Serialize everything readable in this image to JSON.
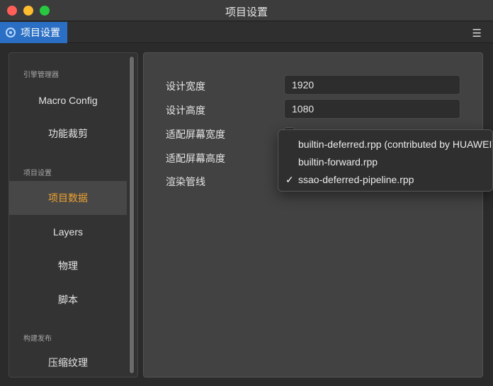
{
  "window": {
    "title": "项目设置"
  },
  "tab": {
    "label": "项目设置",
    "icon": "gear-icon"
  },
  "sidebar": {
    "sections": [
      {
        "title": "引擎管理器",
        "items": [
          {
            "label": "Macro Config"
          },
          {
            "label": "功能裁剪"
          }
        ]
      },
      {
        "title": "项目设置",
        "items": [
          {
            "label": "项目数据",
            "active": true
          },
          {
            "label": "Layers"
          },
          {
            "label": "物理"
          },
          {
            "label": "脚本"
          }
        ]
      },
      {
        "title": "构建发布",
        "items": [
          {
            "label": "压缩纹理"
          }
        ]
      }
    ]
  },
  "form": {
    "design_width": {
      "label": "设计宽度",
      "value": "1920"
    },
    "design_height": {
      "label": "设计高度",
      "value": "1080"
    },
    "fit_width": {
      "label": "适配屏幕宽度"
    },
    "fit_height": {
      "label": "适配屏幕高度"
    },
    "render_pipeline": {
      "label": "渲染管线"
    }
  },
  "dropdown": {
    "options": [
      {
        "label": "builtin-deferred.rpp (contributed by HUAWEI)",
        "selected": false
      },
      {
        "label": "builtin-forward.rpp",
        "selected": false
      },
      {
        "label": "ssao-deferred-pipeline.rpp",
        "selected": true
      }
    ],
    "check_mark": "✓"
  },
  "colors": {
    "accent_tab": "#2a6fc4",
    "active_item": "#f0a230"
  }
}
